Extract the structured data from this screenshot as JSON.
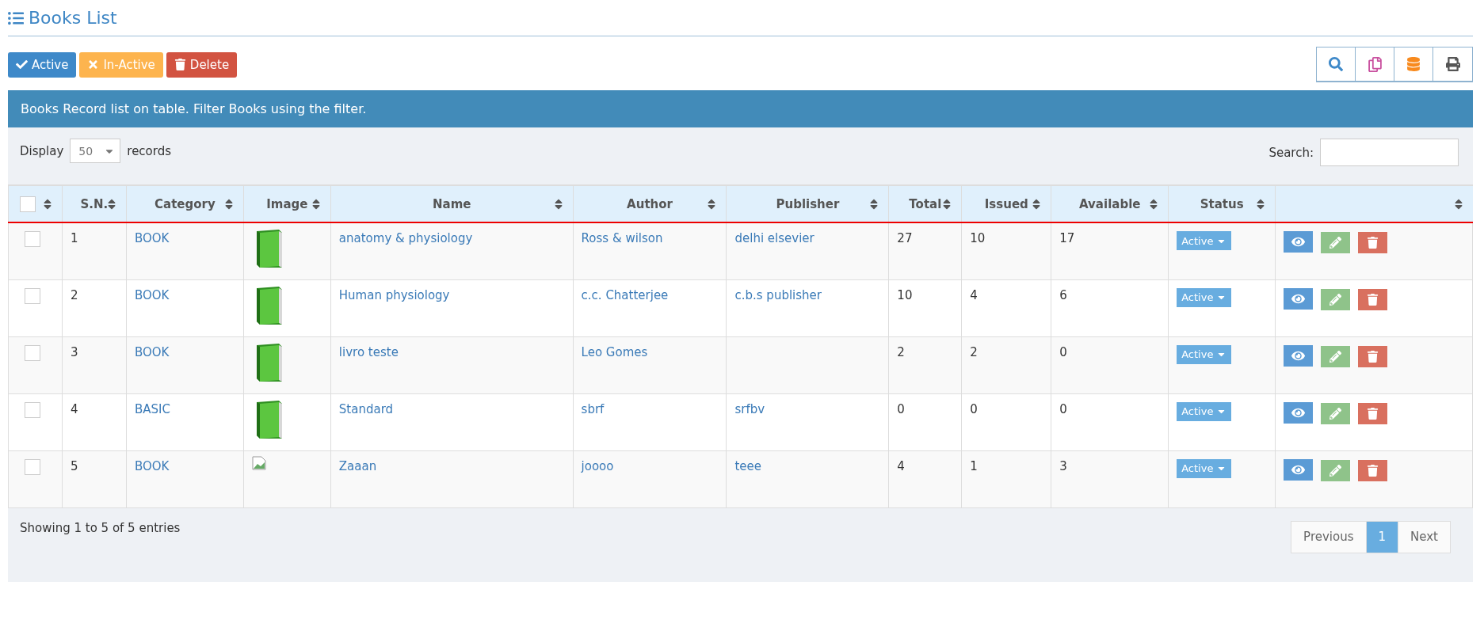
{
  "page_title": "Books List",
  "actions": [
    {
      "label": "Active",
      "kind": "active"
    },
    {
      "label": "In-Active",
      "kind": "inactive"
    },
    {
      "label": "Delete",
      "kind": "delete"
    }
  ],
  "banner": "Books Record list on table. Filter Books using the filter.",
  "length": {
    "prefix": "Display",
    "value": "50",
    "suffix": "records"
  },
  "search": {
    "label": "Search:"
  },
  "table": {
    "select_all": {
      "checked": false
    },
    "columns": [
      "S.N.",
      "Category",
      "Image",
      "Name",
      "Author",
      "Publisher",
      "Total",
      "Issued",
      "Available",
      "Status"
    ],
    "rows": [
      {
        "checked": false,
        "sn": "1",
        "category": "BOOK",
        "kind": "book",
        "name": "anatomy & physiology",
        "author": "Ross & wilson",
        "publisher": "delhi elsevier",
        "total": "27",
        "issued": "10",
        "available": "17",
        "status": "Active"
      },
      {
        "checked": false,
        "sn": "2",
        "category": "BOOK",
        "kind": "book",
        "name": "Human physiology",
        "author": "c.c. Chatterjee",
        "publisher": "c.b.s publisher",
        "total": "10",
        "issued": "4",
        "available": "6",
        "status": "Active"
      },
      {
        "checked": false,
        "sn": "3",
        "category": "BOOK",
        "kind": "book",
        "name": "livro teste",
        "author": "Leo Gomes",
        "publisher": "",
        "total": "2",
        "issued": "2",
        "available": "0",
        "status": "Active"
      },
      {
        "checked": false,
        "sn": "4",
        "category": "BASIC",
        "kind": "book",
        "name": "Standard",
        "author": "sbrf",
        "publisher": "srfbv",
        "total": "0",
        "issued": "0",
        "available": "0",
        "status": "Active"
      },
      {
        "checked": false,
        "sn": "5",
        "category": "BOOK",
        "kind": "broken",
        "name": "Zaaan",
        "author": "joooo",
        "publisher": "teee",
        "total": "4",
        "issued": "1",
        "available": "3",
        "status": "Active"
      }
    ]
  },
  "info": "Showing 1 to 5 of 5 entries",
  "pagination": [
    {
      "label": "Previous",
      "selected": false
    },
    {
      "label": "1",
      "selected": true
    },
    {
      "label": "Next",
      "selected": false
    }
  ]
}
